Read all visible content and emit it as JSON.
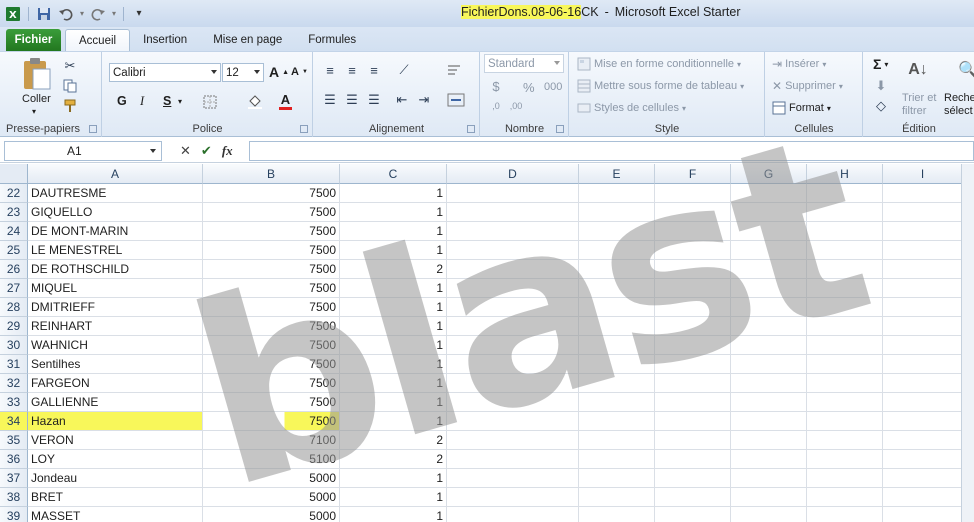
{
  "window": {
    "file_name": "FichierDons.08-06-16",
    "file_suffix": "CK",
    "app_sep": "-",
    "app_name": "Microsoft Excel Starter"
  },
  "tabs": [
    "Fichier",
    "Accueil",
    "Insertion",
    "Mise en page",
    "Formules"
  ],
  "ribbon": {
    "clipboard": {
      "paste": "Coller",
      "label": "Presse-papiers"
    },
    "font": {
      "name": "Calibri",
      "size": "12",
      "label": "Police",
      "bold": "G",
      "italic": "I",
      "underline": "S",
      "grow": "A",
      "shrink": "A",
      "color": "A"
    },
    "alignment": {
      "label": "Alignement"
    },
    "number": {
      "format": "Standard",
      "percent": "%",
      "thousands": "000",
      "label": "Nombre"
    },
    "style": {
      "conditional": "Mise en forme conditionnelle",
      "table": "Mettre sous forme de tableau",
      "cell_styles": "Styles de cellules",
      "label": "Style"
    },
    "cells": {
      "insert": "Insérer",
      "delete": "Supprimer",
      "format": "Format",
      "label": "Cellules"
    },
    "editing": {
      "sum": "Σ",
      "sort_line1": "Trier et",
      "sort_line2": "filtrer",
      "find_line1": "Reche",
      "find_line2": "sélect",
      "label": "Édition"
    }
  },
  "formula_bar": {
    "cell_ref": "A1",
    "cancel": "✕",
    "confirm": "✔",
    "fx": "fx"
  },
  "grid": {
    "columns": [
      "A",
      "B",
      "C",
      "D",
      "E",
      "F",
      "G",
      "H",
      "I"
    ],
    "rows": [
      {
        "n": "22",
        "a": "DAUTRESME",
        "b": "7500",
        "c": "1"
      },
      {
        "n": "23",
        "a": "GIQUELLO",
        "b": "7500",
        "c": "1"
      },
      {
        "n": "24",
        "a": "DE MONT-MARIN",
        "b": "7500",
        "c": "1"
      },
      {
        "n": "25",
        "a": "LE MENESTREL",
        "b": "7500",
        "c": "1"
      },
      {
        "n": "26",
        "a": "DE ROTHSCHILD",
        "b": "7500",
        "c": "2"
      },
      {
        "n": "27",
        "a": "MIQUEL",
        "b": "7500",
        "c": "1"
      },
      {
        "n": "28",
        "a": "DMITRIEFF",
        "b": "7500",
        "c": "1"
      },
      {
        "n": "29",
        "a": "REINHART",
        "b": "7500",
        "c": "1"
      },
      {
        "n": "30",
        "a": "WAHNICH",
        "b": "7500",
        "c": "1"
      },
      {
        "n": "31",
        "a": "Sentilhes",
        "b": "7500",
        "c": "1"
      },
      {
        "n": "32",
        "a": "FARGEON",
        "b": "7500",
        "c": "1"
      },
      {
        "n": "33",
        "a": "GALLIENNE",
        "b": "7500",
        "c": "1"
      },
      {
        "n": "34",
        "a": "Hazan",
        "b": "7500",
        "c": "1",
        "highlight": true
      },
      {
        "n": "35",
        "a": "VERON",
        "b": "7100",
        "c": "2"
      },
      {
        "n": "36",
        "a": "LOY",
        "b": "5100",
        "c": "2"
      },
      {
        "n": "37",
        "a": "Jondeau",
        "b": "5000",
        "c": "1"
      },
      {
        "n": "38",
        "a": "BRET",
        "b": "5000",
        "c": "1"
      },
      {
        "n": "39",
        "a": "MASSET",
        "b": "5000",
        "c": "1"
      }
    ]
  },
  "watermark": "blast",
  "colors": {
    "highlight": "#f8f75a",
    "file_tab": "#2a8a2a",
    "header_text": "#27415f"
  }
}
